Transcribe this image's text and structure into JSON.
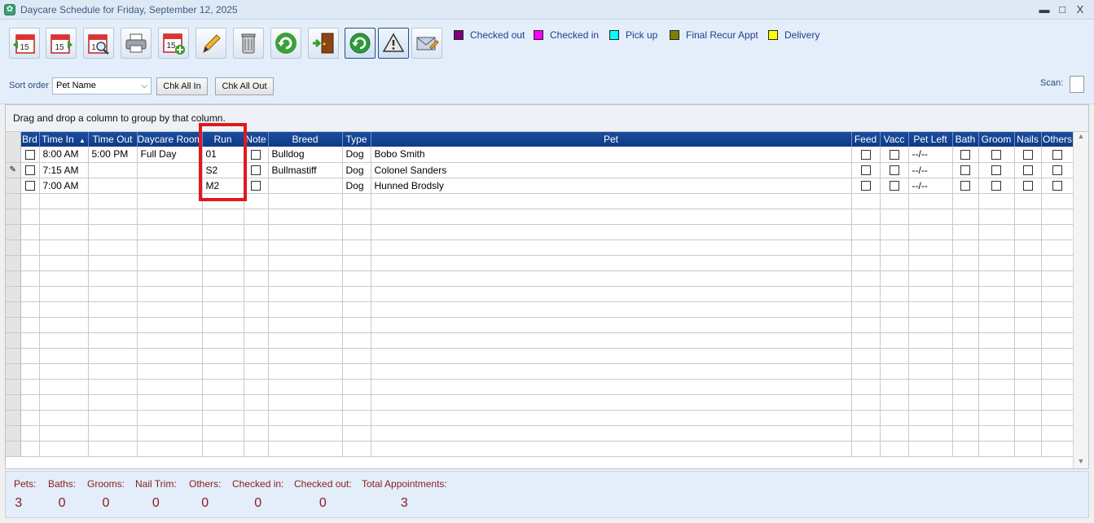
{
  "window": {
    "title": "Daycare Schedule for Friday, September 12, 2025",
    "minimize": "▬",
    "maximize": "□",
    "close": "X"
  },
  "toolbar": {
    "buttons": [
      {
        "name": "previous-day-icon",
        "label": "15"
      },
      {
        "name": "next-day-icon",
        "label": "15"
      },
      {
        "name": "find-date-icon",
        "label": "1"
      },
      {
        "name": "printer-icon"
      },
      {
        "name": "new-appointment-icon",
        "label": "15"
      },
      {
        "name": "pencil-icon"
      },
      {
        "name": "trash-icon"
      },
      {
        "name": "refresh-icon"
      },
      {
        "name": "exit-door-icon"
      },
      {
        "name": "auto-refresh-icon"
      },
      {
        "name": "warning-icon"
      },
      {
        "name": "email-icon"
      }
    ],
    "legend": [
      {
        "label": "Checked out",
        "color": "#800080"
      },
      {
        "label": "Checked in",
        "color": "#ff00ff"
      },
      {
        "label": "Pick up",
        "color": "#00ffff"
      },
      {
        "label": "Final Recur Appt",
        "color": "#808000"
      },
      {
        "label": "Delivery",
        "color": "#ffff00"
      }
    ]
  },
  "sortbar": {
    "label": "Sort order",
    "selected": "Pet Name",
    "chk_all_in": "Chk All In",
    "chk_all_out": "Chk All Out",
    "scan_label": "Scan:"
  },
  "grid": {
    "group_hint": "Drag and drop a column to group by that column.",
    "columns": [
      "Brd",
      "Time In",
      "Time Out",
      "Daycare Room",
      "Run",
      "Note",
      "Breed",
      "Type",
      "Pet",
      "Feed",
      "Vacc",
      "Pet Left",
      "Bath",
      "Groom",
      "Nails",
      "Others"
    ],
    "sort_indicator": "▲",
    "rows": [
      {
        "time_in": "8:00 AM",
        "time_out": "5:00 PM",
        "room": "Full Day",
        "run": "01",
        "breed": "Bulldog",
        "type": "Dog",
        "pet": "Bobo Smith",
        "pet_left": "--/--",
        "current": false
      },
      {
        "time_in": "7:15 AM",
        "time_out": "",
        "room": "",
        "run": "S2",
        "breed": "Bullmastiff",
        "type": "Dog",
        "pet": "Colonel Sanders",
        "pet_left": "--/--",
        "current": true
      },
      {
        "time_in": "7:00 AM",
        "time_out": "",
        "room": "",
        "run": "M2",
        "breed": "",
        "type": "Dog",
        "pet": "Hunned Brodsly",
        "pet_left": "--/--",
        "current": false
      }
    ],
    "current_row_marker": "✎",
    "scroll_up": "▲",
    "scroll_down": "▼"
  },
  "footer": {
    "stats": [
      {
        "label": "Pets:",
        "value": "3"
      },
      {
        "label": "Baths:",
        "value": "0"
      },
      {
        "label": "Grooms:",
        "value": "0"
      },
      {
        "label": "Nail Trim:",
        "value": "0"
      },
      {
        "label": "Others:",
        "value": "0"
      },
      {
        "label": "Checked in:",
        "value": "0"
      },
      {
        "label": "Checked out:",
        "value": "0"
      },
      {
        "label": "Total Appointments:",
        "value": "3"
      }
    ]
  }
}
